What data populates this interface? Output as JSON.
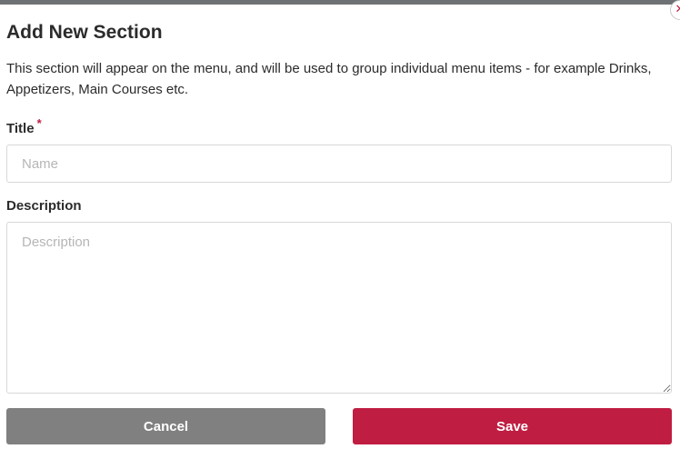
{
  "dialog": {
    "heading": "Add New Section",
    "intro": "This section will appear on the menu, and will be used to group individual menu items - for example Drinks, Appetizers, Main Courses etc.",
    "close_glyph": "✕"
  },
  "form": {
    "title_label": "Title",
    "required_mark": "*",
    "title_placeholder": "Name",
    "description_label": "Description",
    "description_placeholder": "Description"
  },
  "actions": {
    "cancel_label": "Cancel",
    "save_label": "Save"
  },
  "colors": {
    "accent": "#c01d42",
    "cancel": "#808080",
    "top_bar": "#6f7274"
  },
  "icons": {
    "close": "close-icon"
  }
}
